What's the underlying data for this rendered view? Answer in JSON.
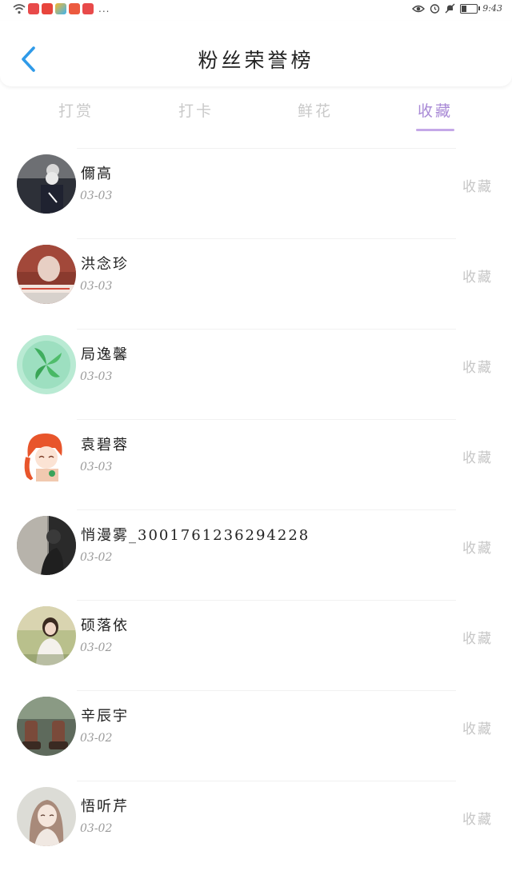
{
  "status_bar": {
    "time": "9:43",
    "more": "...",
    "icons": [
      "wifi-icon",
      "eye-icon",
      "alarm-icon",
      "mute-icon",
      "battery-icon"
    ]
  },
  "header": {
    "title": "粉丝荣誉榜",
    "back_icon": "chevron-left-icon"
  },
  "tabs": [
    {
      "label": "打赏",
      "active": false
    },
    {
      "label": "打卡",
      "active": false
    },
    {
      "label": "鲜花",
      "active": false
    },
    {
      "label": "收藏",
      "active": true
    }
  ],
  "colors": {
    "accent": "#a98ad6",
    "back_arrow": "#2f9ae8"
  },
  "fans": [
    {
      "name": "儞高",
      "date": "03-03",
      "action": "收藏"
    },
    {
      "name": "洪念珍",
      "date": "03-03",
      "action": "收藏"
    },
    {
      "name": "局逸馨",
      "date": "03-03",
      "action": "收藏"
    },
    {
      "name": "袁碧蓉",
      "date": "03-03",
      "action": "收藏"
    },
    {
      "name": "悄漫雾_3001761236294228",
      "date": "03-02",
      "action": "收藏"
    },
    {
      "name": "硕落依",
      "date": "03-02",
      "action": "收藏"
    },
    {
      "name": "辛辰宇",
      "date": "03-02",
      "action": "收藏"
    },
    {
      "name": "悟听芹",
      "date": "03-02",
      "action": "收藏"
    }
  ]
}
